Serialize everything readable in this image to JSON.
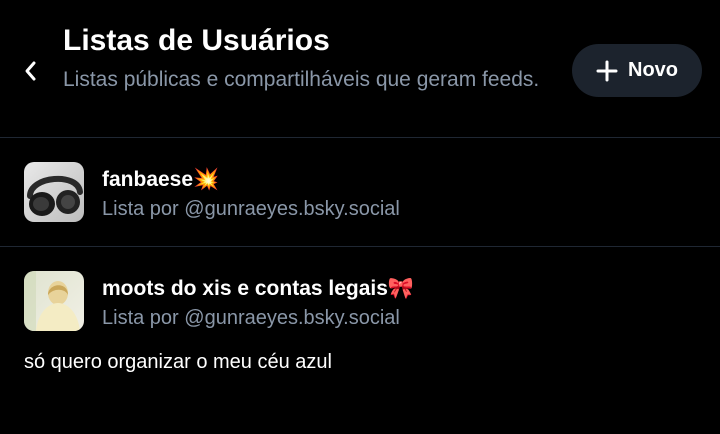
{
  "header": {
    "title": "Listas de Usuários",
    "subtitle": "Listas públicas e compartilháveis que geram feeds.",
    "back_icon": "chevron-left-icon",
    "new_button": {
      "label": "Novo",
      "icon": "plus-icon"
    }
  },
  "lists": [
    {
      "title": "fanbaese💥",
      "byline": "Lista por @gunraeyes.bsky.social",
      "description": "",
      "avatar": "headphones-photo"
    },
    {
      "title": "moots do xis e contas legais🎀",
      "byline": "Lista por @gunraeyes.bsky.social",
      "description": "só quero organizar o meu céu azul",
      "avatar": "person-photo"
    }
  ],
  "colors": {
    "background": "#000000",
    "muted_text": "#8a97a8",
    "button_bg": "#1c232d",
    "divider": "#1f2733"
  }
}
